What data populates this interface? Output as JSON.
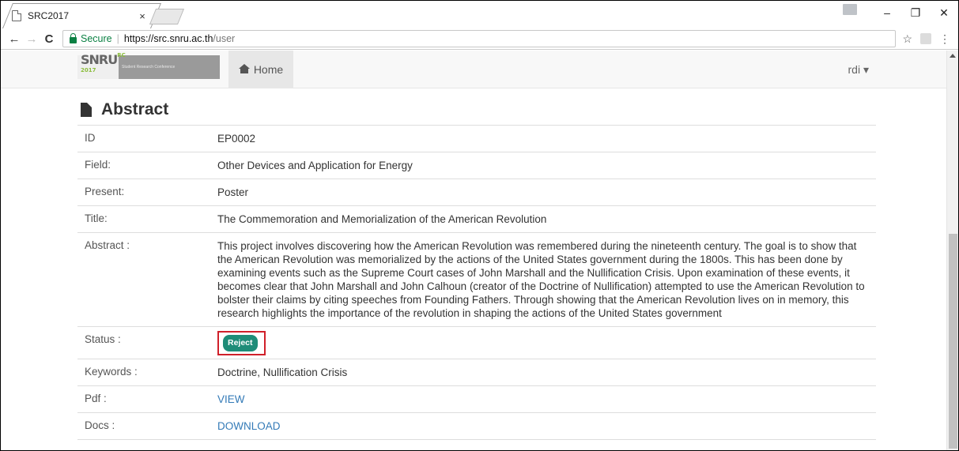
{
  "browser": {
    "tab_title": "SRC2017",
    "tab_close": "×",
    "window_controls": {
      "minimize": "–",
      "restore": "❐",
      "close": "✕"
    },
    "nav": {
      "back": "←",
      "forward": "→",
      "reload": "C"
    },
    "secure_label": "Secure",
    "url_host": "https://src.snru.ac.th",
    "url_path": "/user",
    "bookmark_star": "☆",
    "menu": "⋮"
  },
  "navbar": {
    "brand_main": "SNRU",
    "brand_small": "RC 2017",
    "brand_sub": "Student Research Conference",
    "home_label": "Home",
    "user_label": "rdi ▾"
  },
  "abstract": {
    "heading": "Abstract",
    "rows": [
      {
        "key": "ID",
        "value": "EP0002"
      },
      {
        "key": "Field:",
        "value": "Other Devices and Application for Energy"
      },
      {
        "key": "Present:",
        "value": "Poster"
      },
      {
        "key": "Title:",
        "value": "The Commemoration and Memorialization of the American Revolution"
      },
      {
        "key": "Abstract :",
        "value": "This project involves discovering how the American Revolution was remembered during the nineteenth century. The goal is to show that the American Revolution was memorialized by the actions of the United States government during the 1800s. This has been done by examining events such as the Supreme Court cases of John Marshall and the Nullification Crisis. Upon examination of these events, it becomes clear that John Marshall and John Calhoun (creator of the Doctrine of Nullification) attempted to use the American Revolution to bolster their claims by citing speeches from Founding Fathers. Through showing that the American Revolution lives on in memory, this research highlights the importance of the revolution in shaping the actions of the United States government"
      }
    ],
    "status_key": "Status :",
    "status_value": "Reject",
    "keywords_key": "Keywords :",
    "keywords_value": "Doctrine, Nullification Crisis",
    "pdf_key": "Pdf :",
    "pdf_link": "VIEW",
    "docs_key": "Docs :",
    "docs_link": "DOWNLOAD"
  },
  "colors": {
    "badge": "#1e8c78",
    "highlight": "#d0202a",
    "link": "#337ab7",
    "secure": "#0b8043"
  }
}
